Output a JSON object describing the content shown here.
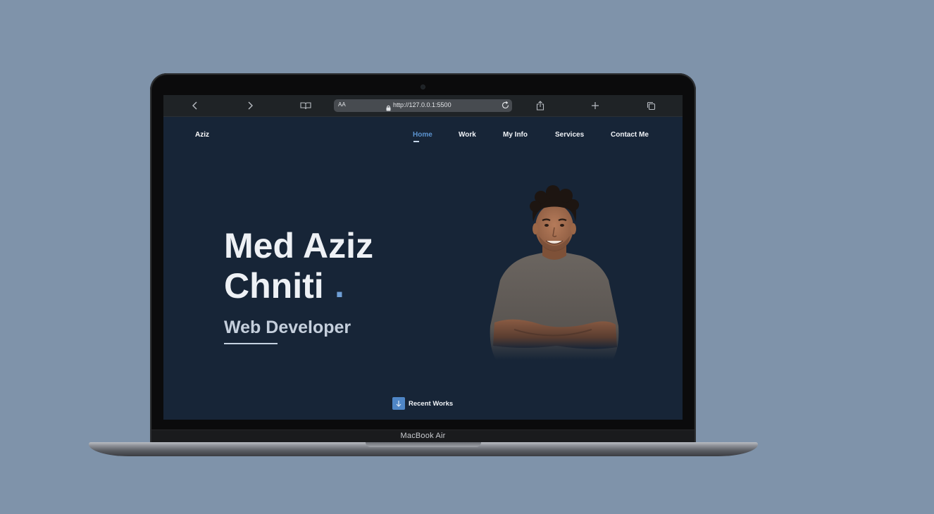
{
  "device": {
    "model_label": "MacBook Air"
  },
  "browser": {
    "url": "http://127.0.0.1:5500",
    "reader_label": "AA",
    "icons": [
      "back-icon",
      "forward-icon",
      "reader-book-icon",
      "lock-icon",
      "reload-icon",
      "share-icon",
      "new-tab-icon",
      "tabs-icon"
    ]
  },
  "site": {
    "brand": "Aziz",
    "nav": [
      {
        "label": "Home",
        "active": true
      },
      {
        "label": "Work",
        "active": false
      },
      {
        "label": "My Info",
        "active": false
      },
      {
        "label": "Services",
        "active": false
      },
      {
        "label": "Contact Me",
        "active": false
      }
    ],
    "hero": {
      "name_line1": "Med Aziz",
      "name_line2": "Chniti",
      "dot": ".",
      "role": "Web Developer"
    },
    "cta": {
      "label": "Recent Works",
      "icon": "arrow-down-icon"
    },
    "colors": {
      "background": "#172537",
      "accent": "#5b93cf"
    }
  }
}
